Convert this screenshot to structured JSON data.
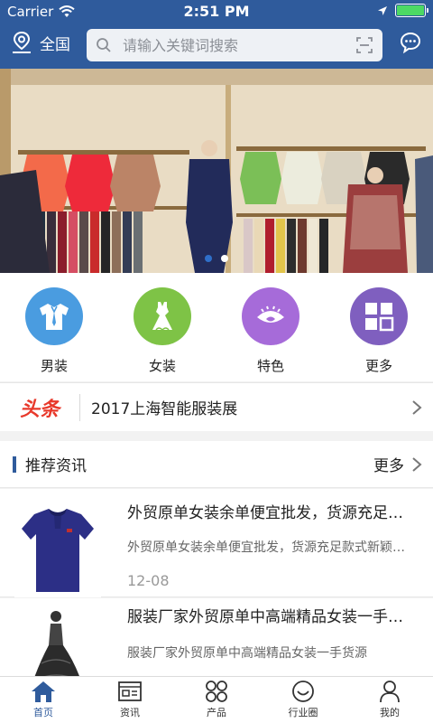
{
  "status_bar": {
    "carrier": "Carrier",
    "time": "2:51 PM"
  },
  "header": {
    "location_label": "全国",
    "search_placeholder": "请输入关键词搜索"
  },
  "banner": {
    "slide_count": 2,
    "active_slide": 1
  },
  "categories": [
    {
      "label": "男装",
      "icon": "shirt-icon",
      "color": "#4a9ce0"
    },
    {
      "label": "女装",
      "icon": "dress-icon",
      "color": "#7ec346"
    },
    {
      "label": "特色",
      "icon": "eye-icon",
      "color": "#a66bd9"
    },
    {
      "label": "更多",
      "icon": "grid-icon",
      "color": "#7f5fbf"
    }
  ],
  "headline": {
    "tag": "头条",
    "text": "2017上海智能服装展"
  },
  "recommended": {
    "title": "推荐资讯",
    "more_label": "更多",
    "items": [
      {
        "title": "外贸原单女装余单便宜批发，货源充足款式新颖",
        "summary": "外贸原单女装余单便宜批发，货源充足款式新颖，欢迎选购",
        "date": "12-08"
      },
      {
        "title": "服装厂家外贸原单中高端精品女装一手货源",
        "summary": "服装厂家外贸原单中高端精品女装一手货源"
      }
    ]
  },
  "tabbar": [
    {
      "label": "首页",
      "icon": "home-icon",
      "active": true
    },
    {
      "label": "资讯",
      "icon": "news-icon",
      "active": false
    },
    {
      "label": "产品",
      "icon": "products-icon",
      "active": false
    },
    {
      "label": "行业圈",
      "icon": "circle-icon",
      "active": false
    },
    {
      "label": "我的",
      "icon": "user-icon",
      "active": false
    }
  ],
  "colors": {
    "brand_blue": "#2f5b9c",
    "headline_red": "#e8392b"
  }
}
